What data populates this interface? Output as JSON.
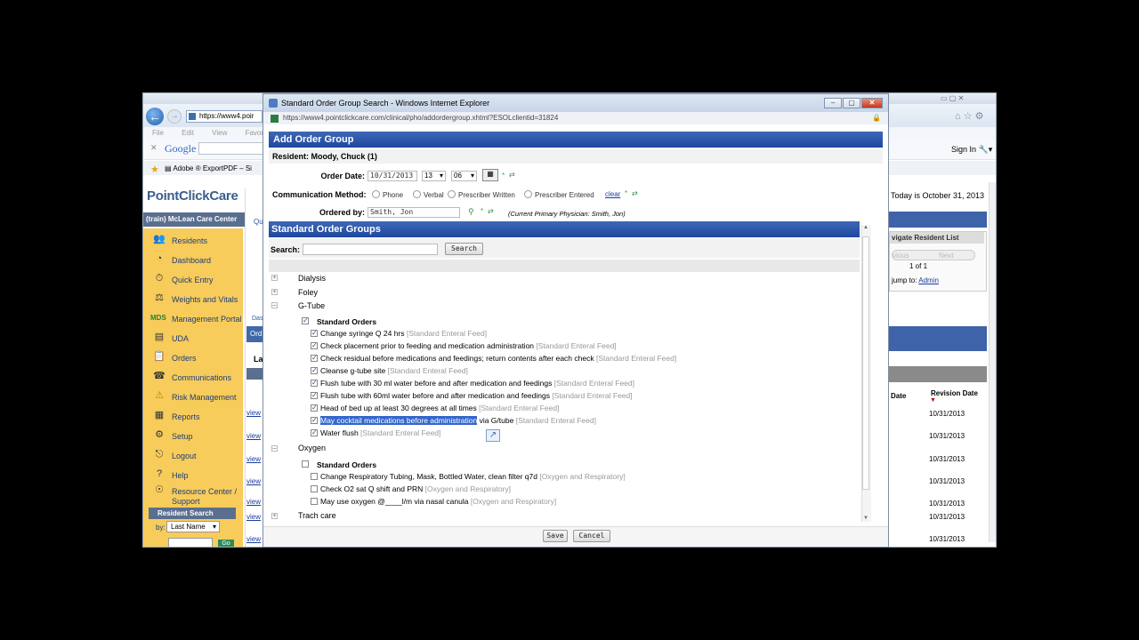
{
  "background_browser": {
    "address": "https://www4.poir",
    "menu": [
      "File",
      "Edit",
      "View",
      "Favorites"
    ],
    "google": "Google",
    "favorites_bar": "Adobe ® ExportPDF – Si",
    "sign_in": "Sign In",
    "logo": "PointClickCare",
    "org": "(train) McLean Care Center",
    "today": "Today is October 31, 2013",
    "sidebar": [
      {
        "label": "Residents",
        "icon": "residents-icon"
      },
      {
        "label": "Dashboard",
        "icon": "dashboard-icon"
      },
      {
        "label": "Quick Entry",
        "icon": "clock-icon"
      },
      {
        "label": "Weights and Vitals",
        "icon": "scale-icon"
      },
      {
        "label": "Management Portal",
        "icon": "mds-icon",
        "prefix": "MDS"
      },
      {
        "label": "UDA",
        "icon": "uda-icon"
      },
      {
        "label": "Orders",
        "icon": "orders-icon"
      },
      {
        "label": "Communications",
        "icon": "communications-icon"
      },
      {
        "label": "Risk Management",
        "icon": "warning-icon"
      },
      {
        "label": "Reports",
        "icon": "reports-icon"
      },
      {
        "label": "Setup",
        "icon": "setup-icon"
      },
      {
        "label": "Logout",
        "icon": "logout-icon"
      },
      {
        "label": "Help",
        "icon": "help-icon"
      },
      {
        "label": "Resource Center / Support",
        "icon": "resource-icon"
      }
    ],
    "resident_search": {
      "title": "Resident Search",
      "by_label": "by:",
      "by_value": "Last Name",
      "go": "Go"
    },
    "mid_tab_top": "Ho",
    "mid_tab_qu": "Qu",
    "mid_tab_das": "Das",
    "mid_tab_ord": "Ord",
    "mid_la": "La",
    "view_link": "view",
    "navigate": {
      "title": "vigate Resident List",
      "previous": "vious",
      "next": "Next",
      "page": "1 of 1",
      "jump_label": "jump to:",
      "jump_link": "Admin"
    },
    "table_headers": {
      "date": "Date",
      "revision": "Revision Date"
    },
    "revision_dates": [
      "10/31/2013",
      "10/31/2013",
      "10/31/2013",
      "10/31/2013",
      "10/31/2013",
      "10/31/2013",
      "10/31/2013"
    ]
  },
  "modal": {
    "window_title": "Standard Order Group Search - Windows Internet Explorer",
    "url": "https://www4.pointclickcare.com/clinical/pho/addordergroup.xhtml?ESOLclientid=31824",
    "header": "Add Order Group",
    "resident": "Resident: Moody, Chuck (1)",
    "order_date_label": "Order Date:",
    "order_date": "10/31/2013",
    "hour": "13",
    "minute": "06",
    "comm_label": "Communication Method:",
    "comm_options": [
      "Phone",
      "Verbal",
      "Prescriber Written",
      "Prescriber Entered"
    ],
    "clear": "clear",
    "ordered_by_label": "Ordered by:",
    "ordered_by": "Smith, Jon",
    "physician_note": "(Current Primary Physician: Smith, Jon)",
    "sog_header": "Standard Order Groups",
    "search_label": "Search:",
    "search_button": "Search",
    "groups": {
      "dialysis": "Dialysis",
      "foley": "Foley",
      "gtube": "G-Tube",
      "oxygen": "Oxygen",
      "trach": "Trach care"
    },
    "standard_orders": "Standard Orders",
    "gtube_items": [
      {
        "text": "Change syringe Q 24 hrs",
        "cat": "[Standard Enteral Feed]"
      },
      {
        "text": "Check placement prior to feeding and medication administration",
        "cat": "[Standard Enteral Feed]"
      },
      {
        "text": "Check residual before medications and feedings; return contents after each check",
        "cat": "[Standard Enteral Feed]"
      },
      {
        "text": "Cleanse g-tube site",
        "cat": "[Standard Enteral Feed]"
      },
      {
        "text": "Flush tube with 30 ml water before and after medication and feedings",
        "cat": "[Standard Enteral Feed]"
      },
      {
        "text": "Flush tube with 60ml water before and after medication and feedings",
        "cat": "[Standard Enteral Feed]"
      },
      {
        "text": "Head of bed up at least 30 degrees at all times",
        "cat": "[Standard Enteral Feed]"
      },
      {
        "text_hl": "May cocktail medications before administration",
        "text_rest": " via G/tube",
        "cat": "[Standard Enteral Feed]"
      },
      {
        "text": "Water flush",
        "cat": "[Standard Enteral Feed]"
      }
    ],
    "oxygen_items": [
      {
        "text": "Change Respiratory Tubing, Mask, Bottled Water, clean filter q7d",
        "cat": "[Oxygen and Respiratory]"
      },
      {
        "text": "Check O2 sat Q shift and PRN",
        "cat": "[Oxygen and Respiratory]"
      },
      {
        "text": "May use oxygen @____l/m via nasal canula",
        "cat": "[Oxygen and Respiratory]"
      }
    ],
    "save": "Save",
    "cancel": "Cancel"
  }
}
